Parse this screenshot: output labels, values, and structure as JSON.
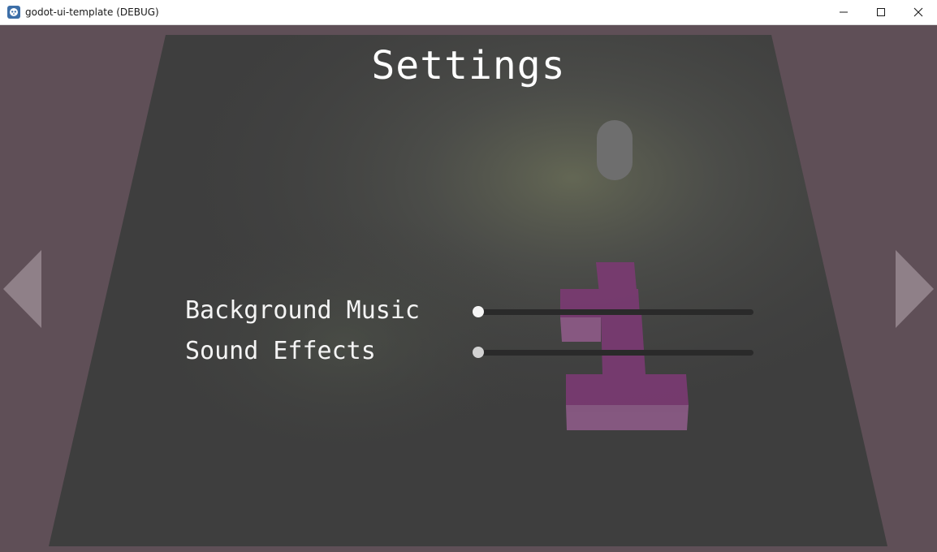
{
  "window": {
    "title": "godot-ui-template (DEBUG)",
    "controls": [
      "minimize",
      "maximize",
      "close"
    ]
  },
  "scene": {
    "title": "Settings",
    "options": [
      {
        "label": "Background Music",
        "value": 0.0,
        "handle_color": "#f5f5f5"
      },
      {
        "label": "Sound Effects",
        "value": 0.0,
        "handle_color": "#d2d2d2"
      }
    ]
  },
  "navigation": {
    "left_icon": "triangle-left-icon",
    "right_icon": "triangle-right-icon"
  },
  "colors": {
    "background": "#5f4f57",
    "board": "#3e3e3e",
    "accent_magenta": "#7a3a72",
    "capsule": "#6e6e6e",
    "text": "#ffffff"
  }
}
